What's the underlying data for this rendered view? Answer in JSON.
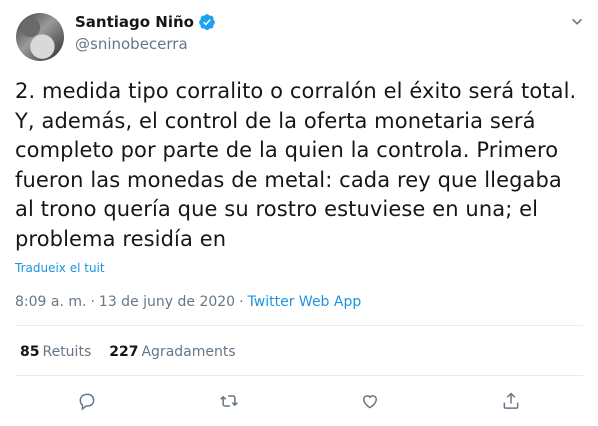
{
  "user": {
    "display_name": "Santiago Niño",
    "handle": "@sninobecerra"
  },
  "tweet": {
    "text": "2. medida tipo corralito o corralón el éxito será total. Y, además, el control de la oferta monetaria será completo por parte de la quien la controla. Primero fueron las monedas de metal: cada rey que llegaba al trono quería que su rostro estuviese en una; el problema residía en",
    "translate_label": "Tradueix el tuit",
    "time": "8:09 a. m.",
    "sep1": "·",
    "date": "13 de juny de 2020",
    "sep2": "·",
    "source": "Twitter Web App"
  },
  "stats": {
    "retweets_count": "85",
    "retweets_label": "Retuits",
    "likes_count": "227",
    "likes_label": "Agradaments"
  },
  "icons": {
    "verified": "verified-badge-icon",
    "caret": "chevron-down-icon",
    "reply": "reply-icon",
    "retweet": "retweet-icon",
    "like": "heart-icon",
    "share": "share-icon"
  },
  "colors": {
    "accent": "#1da1f2",
    "link": "#1b95e0",
    "muted": "#657786",
    "text": "#14171a"
  }
}
